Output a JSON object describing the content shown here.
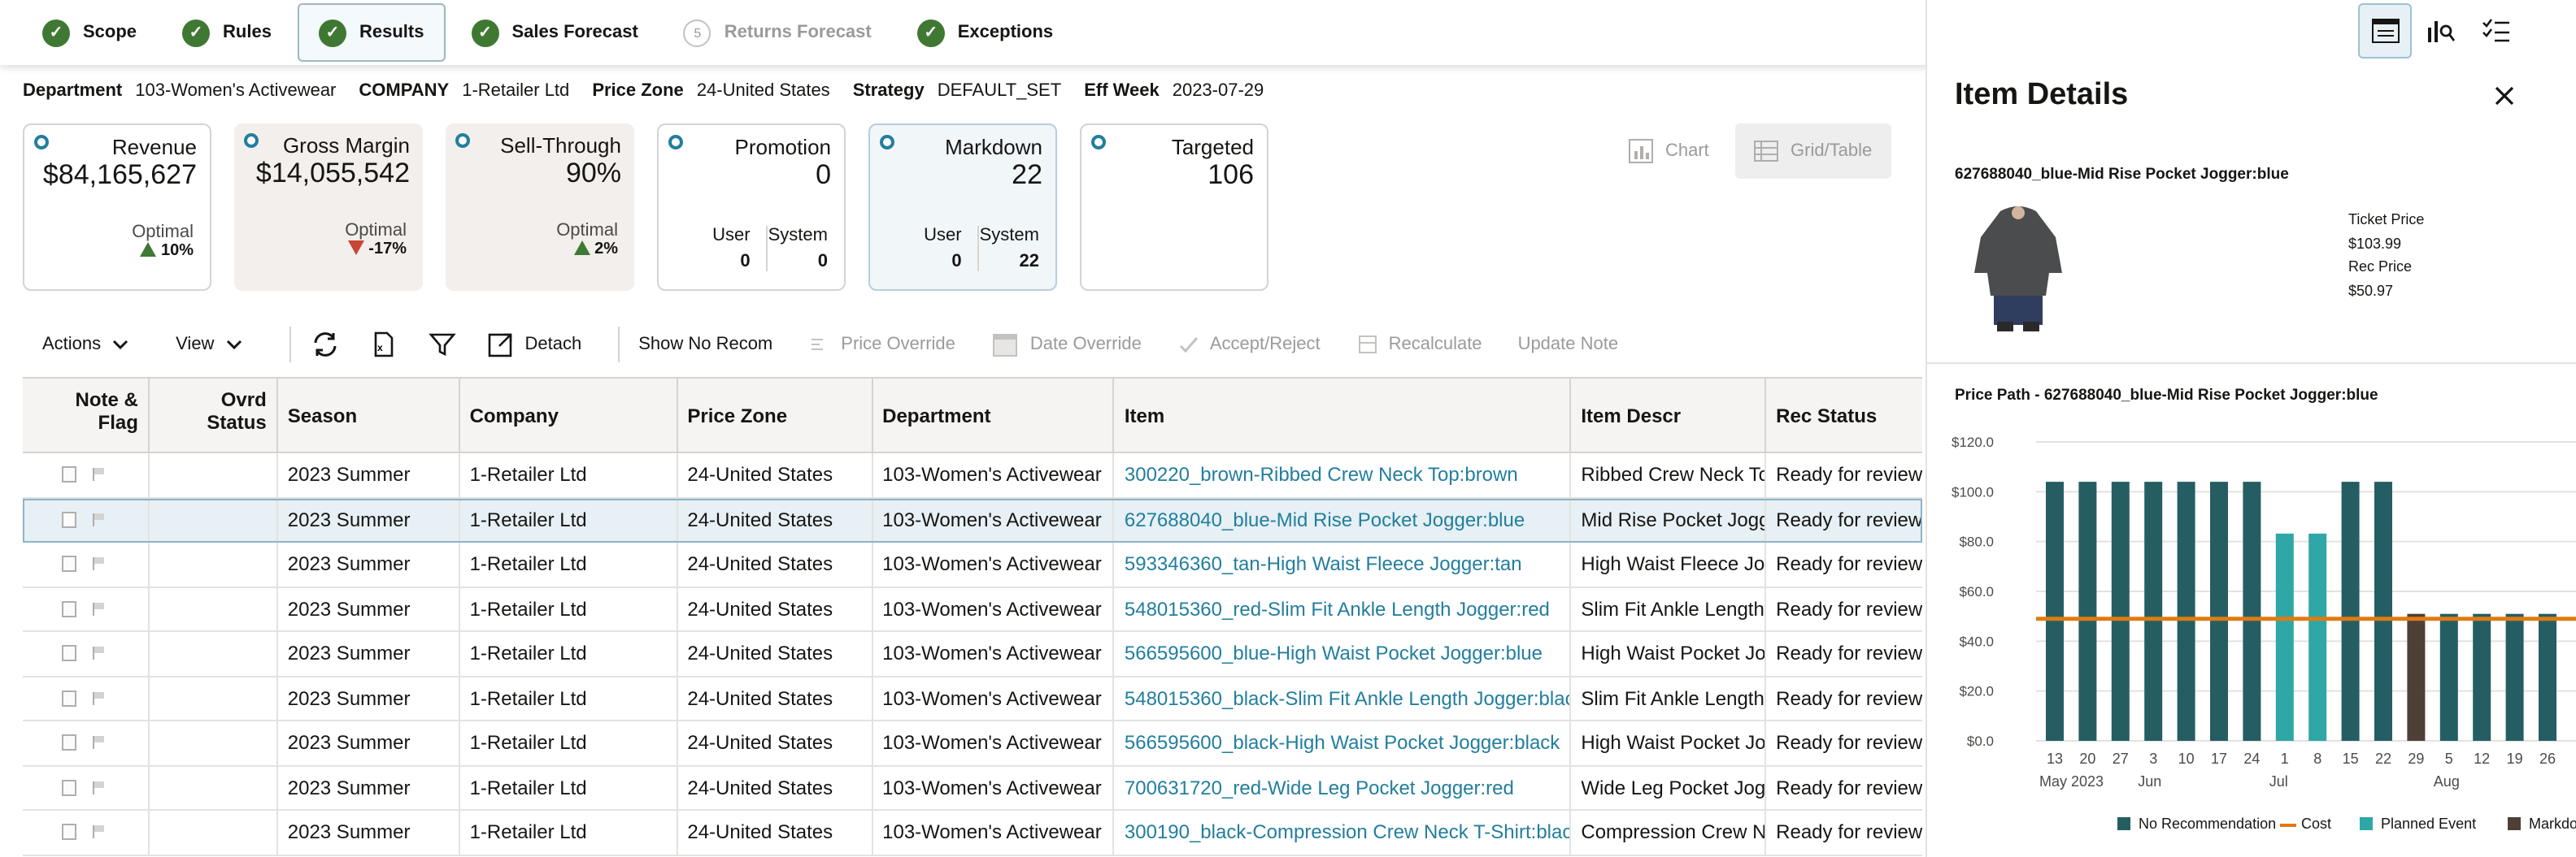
{
  "train": [
    {
      "label": "Scope",
      "state": "done"
    },
    {
      "label": "Rules",
      "state": "done"
    },
    {
      "label": "Results",
      "state": "active"
    },
    {
      "label": "Sales Forecast",
      "state": "done"
    },
    {
      "label": "Returns Forecast",
      "state": "disabled",
      "num": "5"
    },
    {
      "label": "Exceptions",
      "state": "done"
    }
  ],
  "filters": {
    "department_label": "Department",
    "department": "103-Women's Activewear",
    "company_label": "COMPANY",
    "company": "1-Retailer Ltd",
    "zone_label": "Price Zone",
    "zone": "24-United States",
    "strategy_label": "Strategy",
    "strategy": "DEFAULT_SET",
    "week_label": "Eff Week",
    "week": "2023-07-29"
  },
  "tiles": {
    "revenue": {
      "label": "Revenue",
      "value": "$84,165,627",
      "opt_label": "Optimal",
      "opt_value": "10%"
    },
    "margin": {
      "label": "Gross Margin",
      "value": "$14,055,542",
      "opt_label": "Optimal",
      "opt_value": "-17%"
    },
    "sellthru": {
      "label": "Sell-Through",
      "value": "90%",
      "opt_label": "Optimal",
      "opt_value": "2%"
    },
    "promotion": {
      "label": "Promotion",
      "value": "0",
      "user_label": "User",
      "user": "0",
      "system_label": "System",
      "system": "0"
    },
    "markdown": {
      "label": "Markdown",
      "value": "22",
      "user_label": "User",
      "user": "0",
      "system_label": "System",
      "system": "22"
    },
    "targeted": {
      "label": "Targeted",
      "value": "106"
    }
  },
  "view_toggle": {
    "chart": "Chart",
    "grid": "Grid/Table"
  },
  "toolbar": {
    "actions": "Actions",
    "view": "View",
    "detach": "Detach",
    "show_no_recom": "Show No Recom",
    "price_override": "Price Override",
    "date_override": "Date Override",
    "accept_reject": "Accept/Reject",
    "recalculate": "Recalculate",
    "update_note": "Update Note"
  },
  "table": {
    "headers": [
      "Note & Flag",
      "Ovrd Status",
      "Season",
      "Company",
      "Price Zone",
      "Department",
      "Item",
      "Item Descr",
      "Rec Status"
    ],
    "rows": [
      {
        "season": "2023 Summer",
        "company": "1-Retailer Ltd",
        "zone": "24-United States",
        "dept": "103-Women's Activewear",
        "item": "300220_brown-Ribbed Crew Neck Top:brown",
        "descr": "Ribbed Crew Neck To",
        "status": "Ready for review"
      },
      {
        "season": "2023 Summer",
        "company": "1-Retailer Ltd",
        "zone": "24-United States",
        "dept": "103-Women's Activewear",
        "item": "627688040_blue-Mid Rise Pocket Jogger:blue",
        "descr": "Mid Rise Pocket Jogg",
        "status": "Ready for review"
      },
      {
        "season": "2023 Summer",
        "company": "1-Retailer Ltd",
        "zone": "24-United States",
        "dept": "103-Women's Activewear",
        "item": "593346360_tan-High Waist Fleece Jogger:tan",
        "descr": "High Waist Fleece Jo",
        "status": "Ready for review"
      },
      {
        "season": "2023 Summer",
        "company": "1-Retailer Ltd",
        "zone": "24-United States",
        "dept": "103-Women's Activewear",
        "item": "548015360_red-Slim Fit Ankle Length Jogger:red",
        "descr": "Slim Fit Ankle Length",
        "status": "Ready for review"
      },
      {
        "season": "2023 Summer",
        "company": "1-Retailer Ltd",
        "zone": "24-United States",
        "dept": "103-Women's Activewear",
        "item": "566595600_blue-High Waist Pocket Jogger:blue",
        "descr": "High Waist Pocket Jo",
        "status": "Ready for review"
      },
      {
        "season": "2023 Summer",
        "company": "1-Retailer Ltd",
        "zone": "24-United States",
        "dept": "103-Women's Activewear",
        "item": "548015360_black-Slim Fit Ankle Length Jogger:blac",
        "descr": "Slim Fit Ankle Length",
        "status": "Ready for review"
      },
      {
        "season": "2023 Summer",
        "company": "1-Retailer Ltd",
        "zone": "24-United States",
        "dept": "103-Women's Activewear",
        "item": "566595600_black-High Waist Pocket Jogger:black",
        "descr": "High Waist Pocket Jo",
        "status": "Ready for review"
      },
      {
        "season": "2023 Summer",
        "company": "1-Retailer Ltd",
        "zone": "24-United States",
        "dept": "103-Women's Activewear",
        "item": "700631720_red-Wide Leg Pocket Jogger:red",
        "descr": "Wide Leg Pocket Jogg",
        "status": "Ready for review"
      },
      {
        "season": "2023 Summer",
        "company": "1-Retailer Ltd",
        "zone": "24-United States",
        "dept": "103-Women's Activewear",
        "item": "300190_black-Compression Crew Neck T-Shirt:blac",
        "descr": "Compression Crew N",
        "status": "Ready for review"
      }
    ]
  },
  "panel": {
    "title": "Item Details",
    "item": "627688040_blue-Mid Rise Pocket Jogger:blue",
    "ticket_label": "Ticket Price",
    "ticket": "$103.99",
    "rec_label": "Rec Price",
    "rec": "$50.97",
    "path_title": "Price Path  -  627688040_blue-Mid Rise Pocket Jogger:blue"
  },
  "chart_data": {
    "type": "bar",
    "title": "Price Path  -  627688040_blue-Mid Rise Pocket Jogger:blue",
    "categories": [
      "13",
      "20",
      "27",
      "3",
      "10",
      "17",
      "24",
      "1",
      "8",
      "15",
      "22",
      "29",
      "5",
      "12",
      "19",
      "26"
    ],
    "month_labels": [
      "May 2023",
      "Jun",
      "Jul",
      "Aug"
    ],
    "yticks": [
      "$0.0",
      "$20.0",
      "$40.0",
      "$60.0",
      "$80.0",
      "$100.0",
      "$120.0"
    ],
    "ylim": [
      0,
      120
    ],
    "values": [
      103.99,
      103.99,
      103.99,
      103.99,
      103.99,
      103.99,
      103.99,
      83.19,
      83.19,
      103.99,
      103.99,
      50.97,
      50.97,
      50.97,
      50.97,
      50.97
    ],
    "bar_types": [
      "none",
      "none",
      "none",
      "none",
      "none",
      "none",
      "none",
      "event",
      "event",
      "none",
      "none",
      "markdown",
      "none",
      "none",
      "none",
      "none"
    ],
    "cost": 49.0,
    "legend": [
      "No Recommendation",
      "Cost",
      "Planned Event",
      "Markdo"
    ],
    "colors": {
      "none": "#245e63",
      "event": "#2fa7a6",
      "markdown": "#4e3f37",
      "cost": "#e07b12"
    }
  }
}
